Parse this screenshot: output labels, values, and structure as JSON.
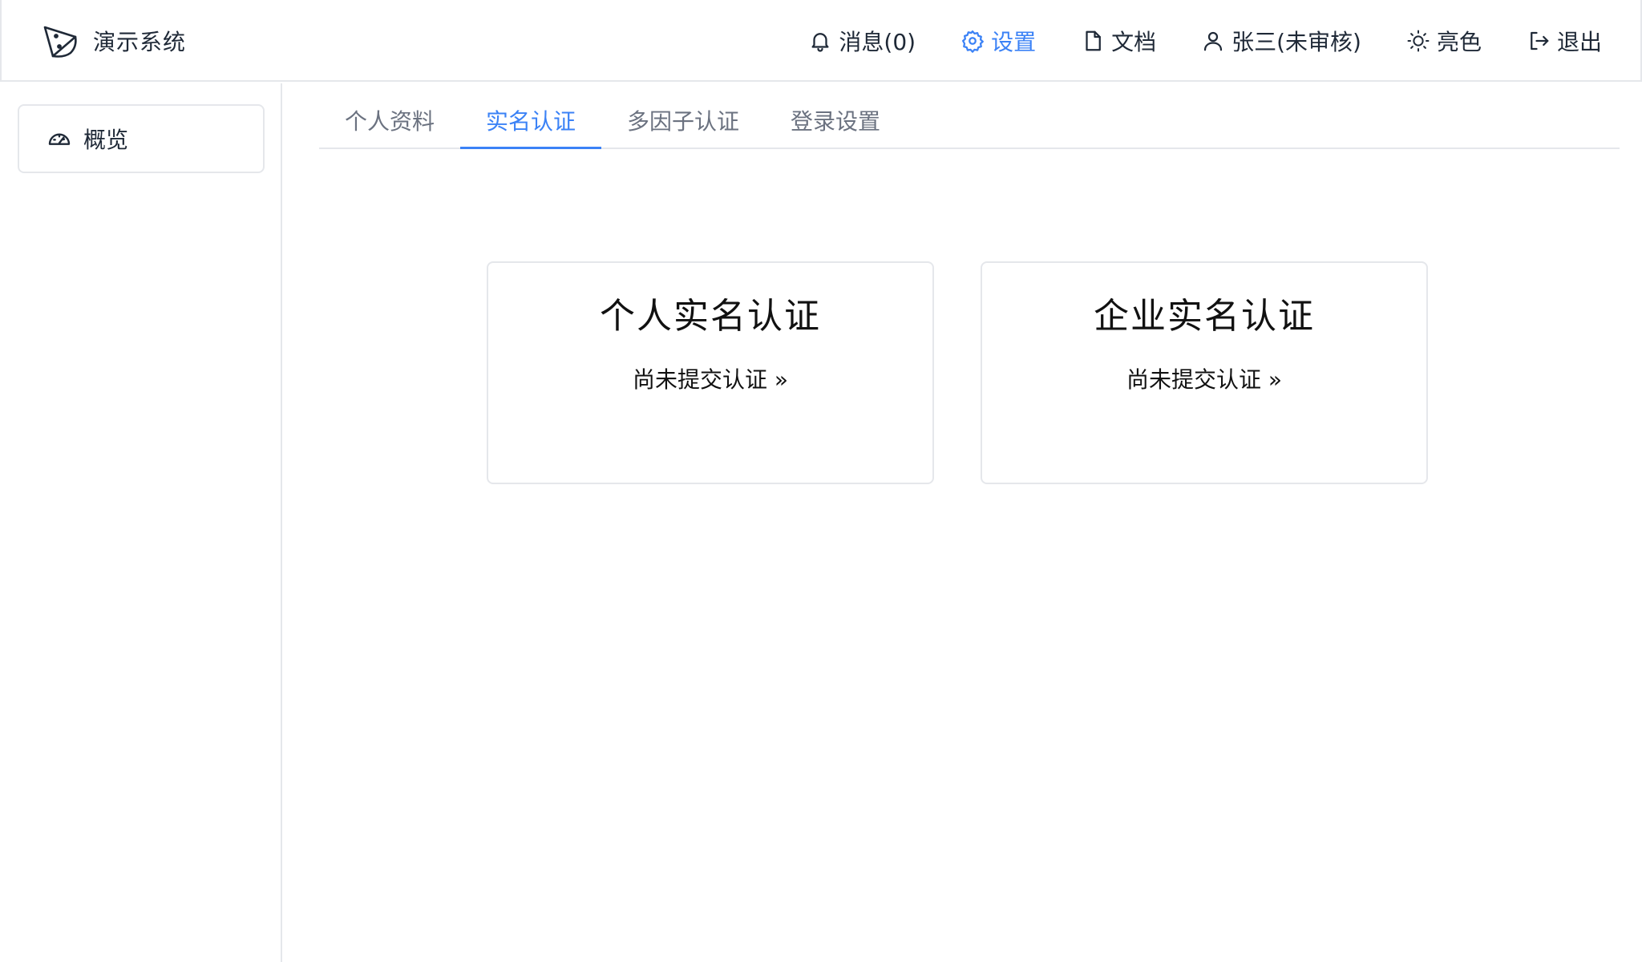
{
  "brand": {
    "name": "演示系统",
    "logo_icon": "pizza-logo-icon"
  },
  "nav": {
    "messages": {
      "label": "消息(0)",
      "icon": "bell-icon"
    },
    "settings": {
      "label": "设置",
      "icon": "gear-icon",
      "active": true
    },
    "docs": {
      "label": "文档",
      "icon": "file-icon"
    },
    "user": {
      "label": "张三(未审核)",
      "icon": "user-icon"
    },
    "theme": {
      "label": "亮色",
      "icon": "sun-icon"
    },
    "logout": {
      "label": "退出",
      "icon": "logout-icon"
    }
  },
  "sidebar": {
    "items": [
      {
        "label": "概览",
        "icon": "gauge-icon"
      }
    ]
  },
  "tabs": [
    {
      "label": "个人资料",
      "active": false
    },
    {
      "label": "实名认证",
      "active": true
    },
    {
      "label": "多因子认证",
      "active": false
    },
    {
      "label": "登录设置",
      "active": false
    }
  ],
  "cards": [
    {
      "title": "个人实名认证",
      "status": "尚未提交认证 »"
    },
    {
      "title": "企业实名认证",
      "status": "尚未提交认证 »"
    }
  ],
  "colors": {
    "accent": "#3b82f6",
    "text": "#1f2937",
    "muted": "#6b7280",
    "border": "#e5e7eb"
  }
}
